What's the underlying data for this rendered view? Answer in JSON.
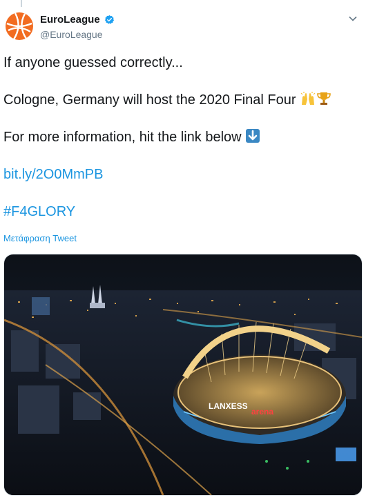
{
  "author": {
    "display_name": "EuroLeague",
    "handle": "@EuroLeague",
    "verified": true,
    "avatar_icon": "euroleague-logo-icon"
  },
  "tweet": {
    "line1": "If anyone guessed correctly...",
    "line2": "Cologne, Germany will host the 2020 Final Four",
    "line2_emojis": [
      "raised-hands-icon",
      "trophy-icon"
    ],
    "line3": "For more information, hit the link below",
    "line3_emoji": "down-arrow-icon",
    "link": "bit.ly/2O0MmPB",
    "hashtag": "#F4GLORY"
  },
  "translate_label": "Μετάφραση Tweet",
  "media": {
    "arena_sign_1": "LANXESS",
    "arena_sign_2": "arena"
  },
  "colors": {
    "link": "#1b95e0",
    "text": "#14171a",
    "secondary": "#657786",
    "brand_orange": "#f26c21"
  }
}
